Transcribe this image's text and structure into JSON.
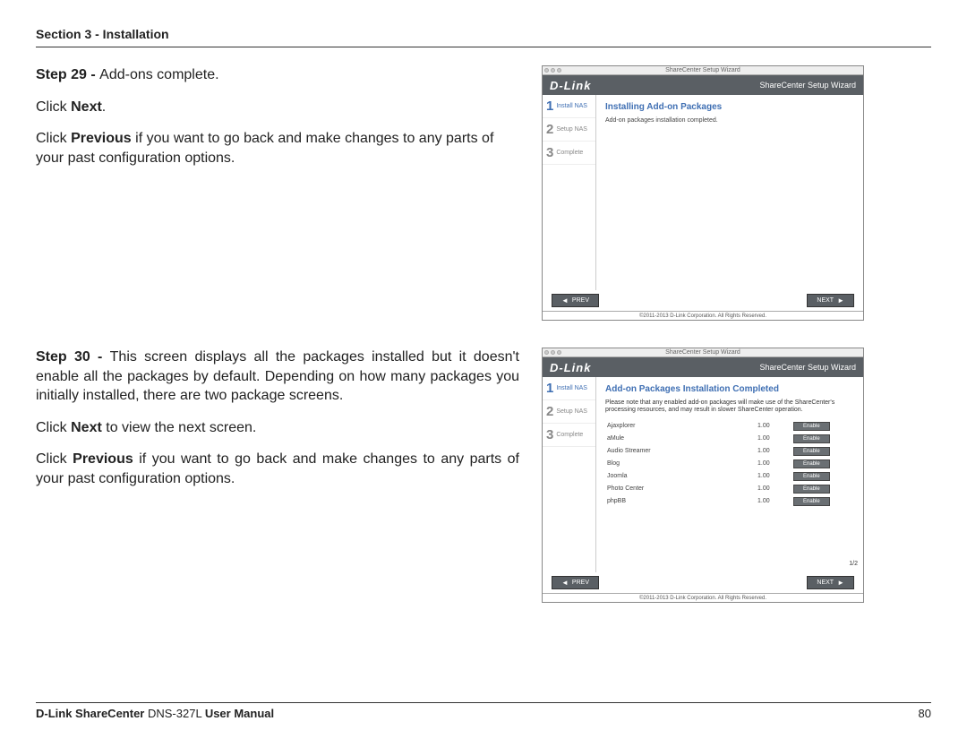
{
  "header": {
    "section": "Section 3 - Installation"
  },
  "step29": {
    "title_bold": "Step 29 - ",
    "title_rest": "Add-ons complete.",
    "p2a": "Click ",
    "p2b": "Next",
    "p2c": ".",
    "p3a": "Click ",
    "p3b": "Previous",
    "p3c": " if you want to go back and make changes to any parts of your past configuration options."
  },
  "step30": {
    "title_bold": "Step 30 - ",
    "title_rest": "This screen displays all the packages installed but it doesn't enable all the packages by default. Depending on how many packages you initially installed, there are two package screens.",
    "p2a": "Click ",
    "p2b": "Next",
    "p2c": " to view the next screen.",
    "p3a": "Click ",
    "p3b": "Previous",
    "p3c": " if you want to go back and make changes to any parts of your past configuration options."
  },
  "shot": {
    "win_title": "ShareCenter Setup Wizard",
    "brand": "D-Link",
    "brand_sub": "ShareCenter Setup Wizard",
    "steps": [
      {
        "num": "1",
        "lab": "Install NAS"
      },
      {
        "num": "2",
        "lab": "Setup NAS"
      },
      {
        "num": "3",
        "lab": "Complete"
      }
    ],
    "prev": "PREV",
    "next": "NEXT",
    "copy": "©2011-2013 D-Link Corporation. All Rights Reserved."
  },
  "shot1_main": {
    "heading": "Installing Add-on Packages",
    "msg": "Add-on packages installation completed."
  },
  "shot2_main": {
    "heading": "Add-on Packages Installation Completed",
    "note": "Please note that any enabled add-on packages will make use of the ShareCenter's processing resources, and may result in slower ShareCenter operation.",
    "enable": "Enable",
    "fraction": "1/2",
    "packages": [
      {
        "name": "Ajaxplorer",
        "ver": "1.00"
      },
      {
        "name": "aMule",
        "ver": "1.00"
      },
      {
        "name": "Audio Streamer",
        "ver": "1.00"
      },
      {
        "name": "Blog",
        "ver": "1.00"
      },
      {
        "name": "Joomla",
        "ver": "1.00"
      },
      {
        "name": "Photo Center",
        "ver": "1.00"
      },
      {
        "name": "phpBB",
        "ver": "1.00"
      }
    ]
  },
  "footer": {
    "left_a": "D-Link ShareCenter ",
    "left_b": "DNS-327L ",
    "left_c": "User Manual",
    "page": "80"
  }
}
